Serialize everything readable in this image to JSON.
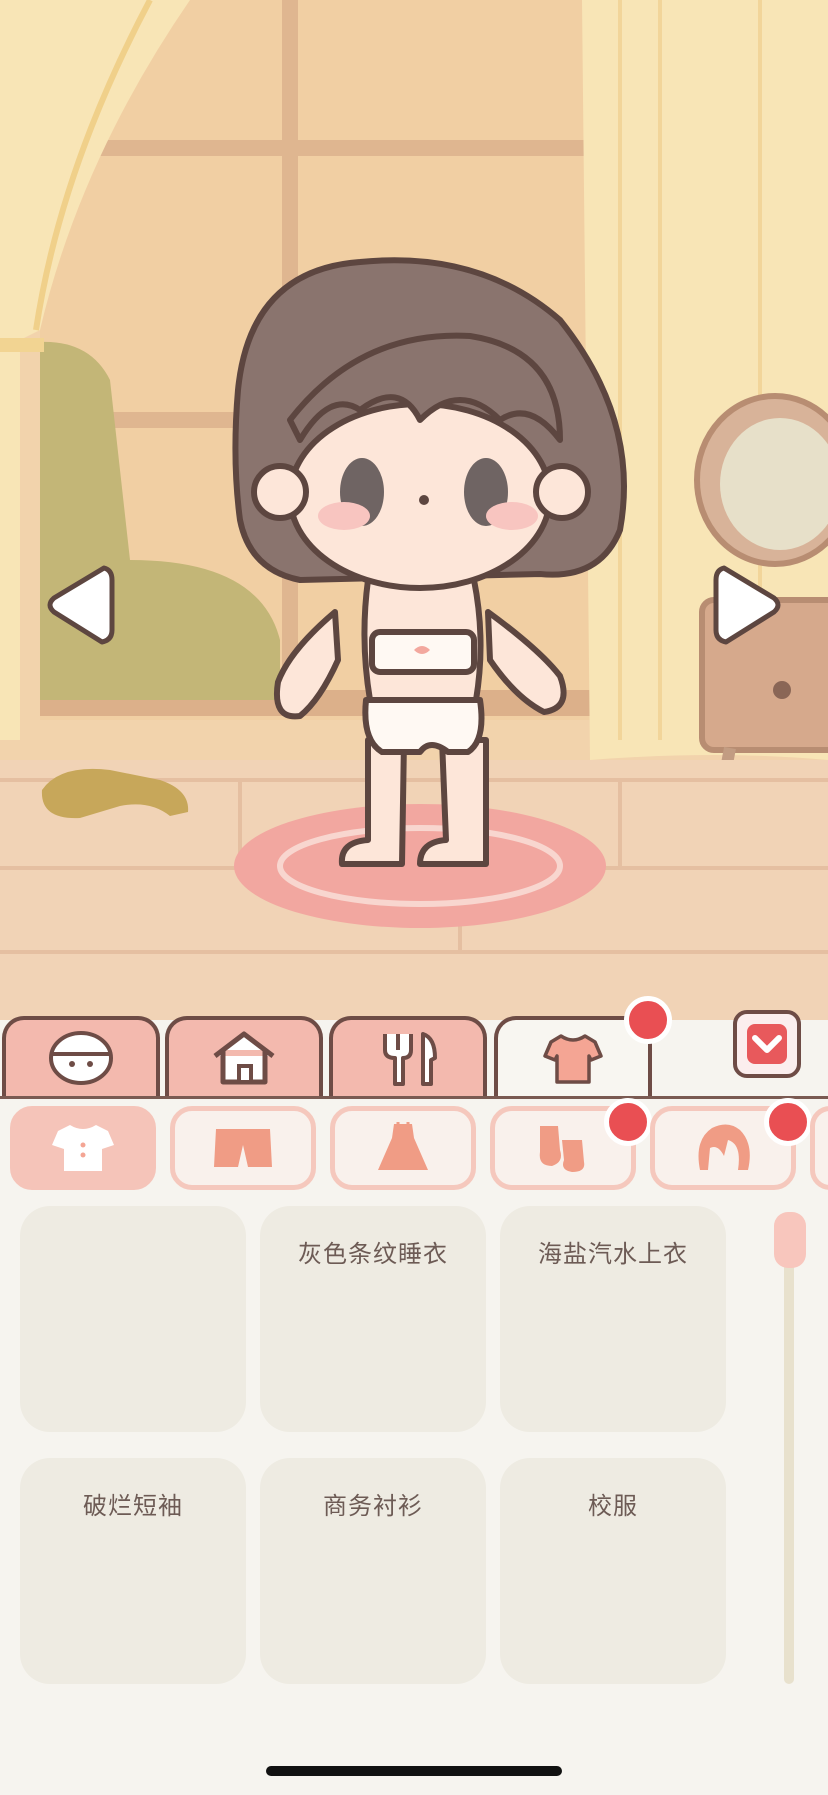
{
  "colors": {
    "accent": "#f3b9ae",
    "badge": "#e94f53",
    "outline": "#6e4c46",
    "panel_bg": "#f6f4ef",
    "card_bg": "#eeebe2"
  },
  "top_tabs": [
    {
      "icon": "face-icon",
      "active": false,
      "badge": false
    },
    {
      "icon": "house-icon",
      "active": false,
      "badge": false
    },
    {
      "icon": "fork-knife-icon",
      "active": false,
      "badge": false
    },
    {
      "icon": "shirt-icon",
      "active": true,
      "badge": true
    }
  ],
  "collapse_icon": "chevron-down-icon",
  "sub_tabs": [
    {
      "icon": "top-shirt-icon",
      "active": true,
      "badge": false
    },
    {
      "icon": "shorts-icon",
      "active": false,
      "badge": false
    },
    {
      "icon": "dress-icon",
      "active": false,
      "badge": false
    },
    {
      "icon": "socks-icon",
      "active": false,
      "badge": true
    },
    {
      "icon": "hair-icon",
      "active": false,
      "badge": true
    }
  ],
  "items": [
    {
      "label": ""
    },
    {
      "label": "灰色条纹睡衣"
    },
    {
      "label": "海盐汽水上衣"
    },
    {
      "label": "破烂短袖"
    },
    {
      "label": "商务衬衫"
    },
    {
      "label": "校服"
    }
  ]
}
